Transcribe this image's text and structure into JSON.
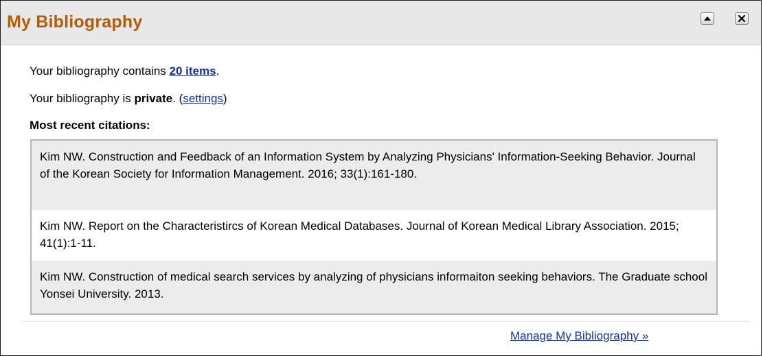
{
  "header": {
    "title": "My Bibliography"
  },
  "summary": {
    "contains_prefix": "Your bibliography contains ",
    "items_link": "20 items",
    "contains_suffix": ".",
    "privacy_prefix": "Your bibliography is ",
    "privacy_value": "private",
    "privacy_mid": ". (",
    "settings_link": "settings",
    "privacy_suffix": ")",
    "recent_heading": "Most recent citations:"
  },
  "citations": [
    "Kim NW. Construction and Feedback of an Information System by Analyzing Physicians' Information-Seeking Behavior. Journal of the Korean Society for Information Management. 2016; 33(1):161-180.",
    "Kim NW. Report on the Characteristircs of Korean Medical Databases. Journal of Korean Medical Library Association. 2015; 41(1):1-11.",
    "Kim NW. Construction of medical search services by analyzing of physicians informaiton seeking behaviors. The Graduate school Yonsei University. 2013."
  ],
  "footer": {
    "manage_link": "Manage My Bibliography »"
  },
  "colors": {
    "title": "#b25d06",
    "link": "#15339a",
    "header_bg": "#e8e8e8",
    "citation_alt_bg": "#ececec"
  },
  "icons": {
    "collapse": "collapse-icon",
    "close": "close-icon"
  }
}
